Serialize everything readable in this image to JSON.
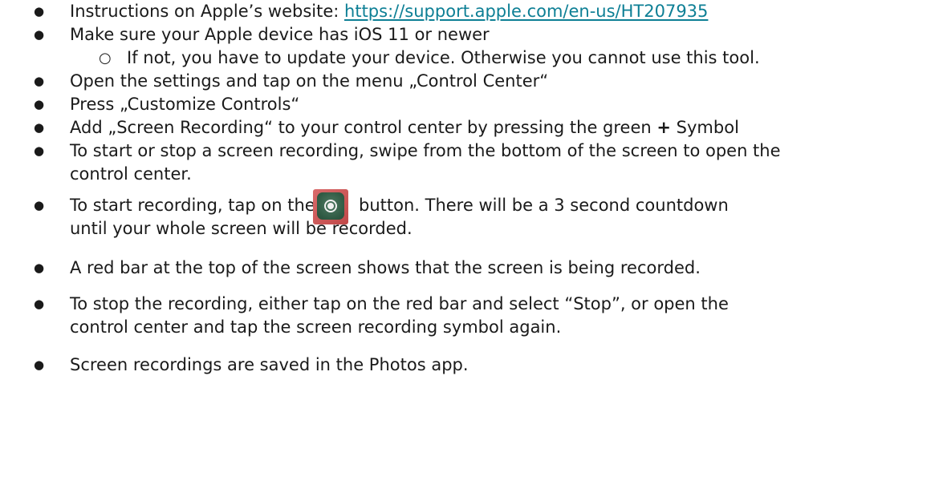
{
  "items": [
    {
      "prefix": "Instructions on Apple’s website: ",
      "link": "https://support.apple.com/en-us/HT207935"
    },
    {
      "text": "Make sure your Apple device has iOS 11 or newer",
      "sub_text": "If not, you have to update your device. Otherwise you cannot use this tool."
    },
    {
      "text": "Open the settings and tap on the menu „Control Center“"
    },
    {
      "text": "Press „Customize Controls“"
    },
    {
      "text_before": "Add „Screen Recording“ to your control center by pressing the green ",
      "plus": "+",
      "text_after": " Symbol"
    },
    {
      "line1": "To start or stop a screen recording, swipe from the bottom of the screen to open the",
      "line2": "control center."
    },
    {
      "text_before": "To start recording, tap on the",
      "text_after": "button. There will be a 3 second countdown",
      "line2": "until your whole screen will be recorded.",
      "icon": "screen-record-icon"
    },
    {
      "text": "A red bar at the top of the screen shows that the screen is being recorded."
    },
    {
      "line1": "To stop the recording, either tap on the red bar and select “Stop”, or open the",
      "line2": "control center and tap the screen recording symbol again."
    },
    {
      "text": "Screen recordings are saved in the Photos app."
    }
  ],
  "colors": {
    "link": "#0d7f95",
    "text": "#1a1a1a",
    "record_icon_frame": "#c04848",
    "record_icon_fill": "#2f5a43"
  }
}
